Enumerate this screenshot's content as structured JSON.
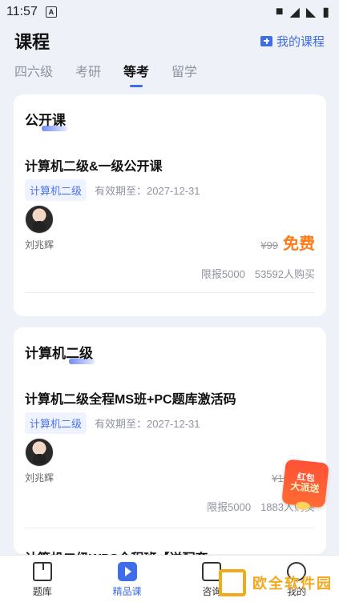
{
  "status_bar": {
    "time": "11:57",
    "left_icon_letter": "A",
    "right_icons": [
      "briefcase-icon",
      "wifi-icon",
      "signal-icon",
      "battery-icon"
    ]
  },
  "header": {
    "title": "课程",
    "my_course_label": "我的课程"
  },
  "tabs": [
    {
      "label": "四六级",
      "active": false
    },
    {
      "label": "考研",
      "active": false
    },
    {
      "label": "等考",
      "active": true
    },
    {
      "label": "留学",
      "active": false
    }
  ],
  "cards": [
    {
      "section_title": "公开课",
      "course_name": "计算机二级&一级公开课",
      "tag": "计算机二级",
      "expiry": "有效期至：2027-12-31",
      "teacher": "刘兆辉",
      "old_price": "¥99",
      "price": "免费",
      "limit": "限报5000",
      "sold": "53592人购买"
    },
    {
      "section_title": "计算机二级",
      "course_name": "计算机二级全程MS班+PC题库激活码",
      "tag": "计算机二级",
      "expiry": "有效期至：2027-12-31",
      "teacher": "刘兆辉",
      "old_price": "¥199",
      "price": "¥1",
      "limit": "限报5000",
      "sold": "1883人购买"
    }
  ],
  "next_course_partial": "计算机二级WPS全程班【送配套",
  "promo_badge": {
    "top": "红包",
    "bottom": "大派送"
  },
  "bottom_nav": [
    {
      "label": "题库",
      "icon": "book-icon",
      "active": false
    },
    {
      "label": "精品课",
      "icon": "video-icon",
      "active": true
    },
    {
      "label": "咨询",
      "icon": "consult-icon",
      "active": false
    },
    {
      "label": "我的",
      "icon": "profile-icon",
      "active": false
    }
  ],
  "watermark": {
    "text": "欧全软件园"
  }
}
